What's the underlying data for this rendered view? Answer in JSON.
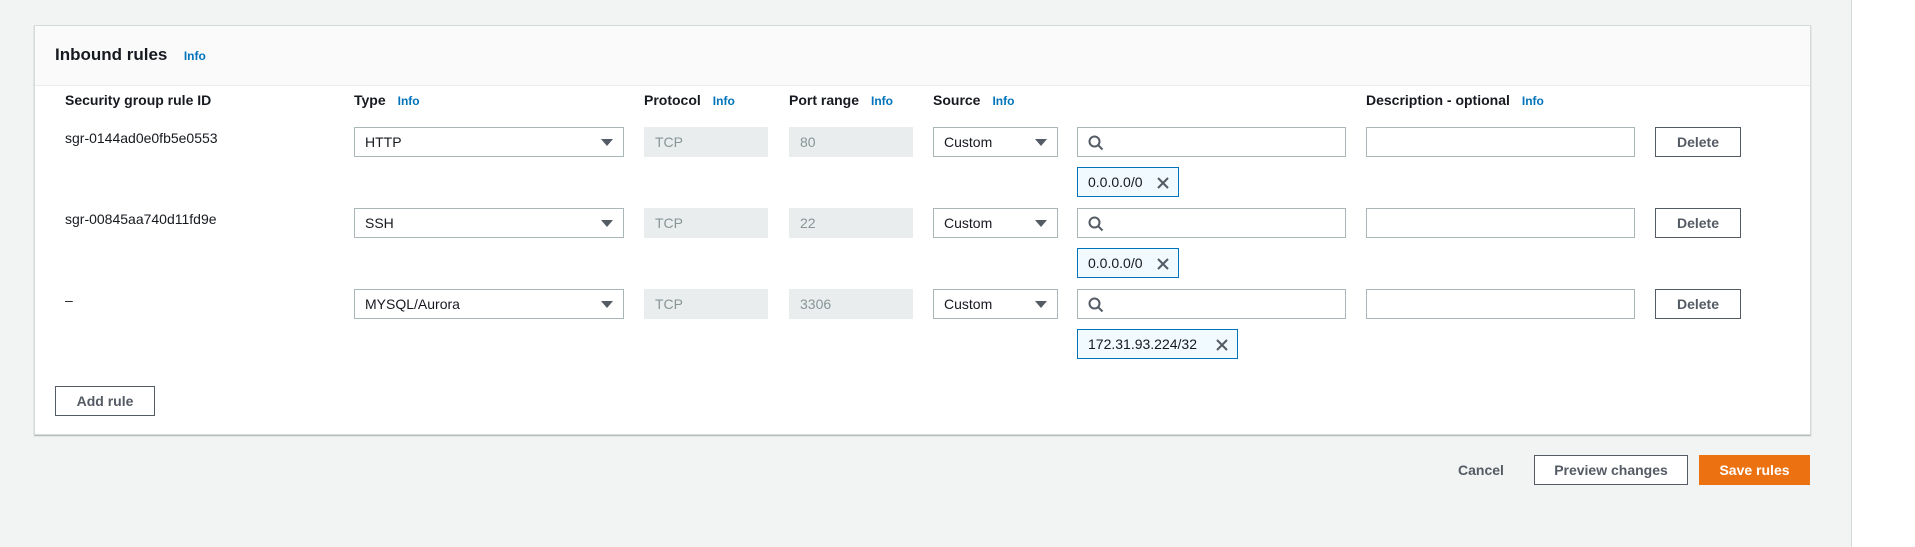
{
  "panel": {
    "title": "Inbound rules",
    "info": "Info"
  },
  "columns": {
    "rule_id": "Security group rule ID",
    "type": "Type",
    "type_info": "Info",
    "protocol": "Protocol",
    "protocol_info": "Info",
    "port_range": "Port range",
    "port_range_info": "Info",
    "source": "Source",
    "source_info": "Info",
    "description": "Description - optional",
    "description_info": "Info"
  },
  "rules": [
    {
      "id": "sgr-0144ad0e0fb5e0553",
      "type": "HTTP",
      "protocol": "TCP",
      "port": "80",
      "source": "Custom",
      "search_value": "",
      "token": "0.0.0.0/0",
      "description": "",
      "delete": "Delete"
    },
    {
      "id": "sgr-00845aa740d11fd9e",
      "type": "SSH",
      "protocol": "TCP",
      "port": "22",
      "source": "Custom",
      "search_value": "",
      "token": "0.0.0.0/0",
      "description": "",
      "delete": "Delete"
    },
    {
      "id": "–",
      "type": "MYSQL/Aurora",
      "protocol": "TCP",
      "port": "3306",
      "source": "Custom",
      "search_value": "",
      "token": "172.31.93.224/32",
      "description": "",
      "delete": "Delete"
    }
  ],
  "add_rule": "Add rule",
  "footer": {
    "cancel": "Cancel",
    "preview": "Preview changes",
    "save": "Save rules"
  },
  "colors": {
    "accent": "#0073bb",
    "primary_button": "#ec7211"
  }
}
